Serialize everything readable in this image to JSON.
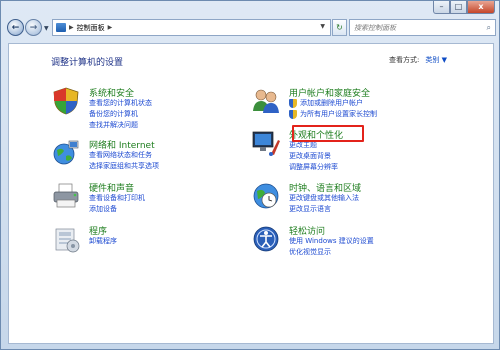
{
  "window": {
    "controls": {
      "minimize": "–",
      "maximize": "□",
      "close": "x"
    }
  },
  "nav": {
    "back_icon": "←",
    "forward_icon": "→",
    "breadcrumb": [
      "控制面板"
    ],
    "refresh_icon": "↻",
    "search_placeholder": "搜索控制面板"
  },
  "page": {
    "title": "调整计算机的设置",
    "view_by_label": "查看方式:",
    "view_by_value": "类别 ▼"
  },
  "categories": [
    {
      "title": "系统和安全",
      "links": [
        "查看您的计算机状态",
        "备份您的计算机",
        "查找并解决问题"
      ]
    },
    {
      "title": "网络和 Internet",
      "links": [
        "查看网络状态和任务",
        "选择家庭组和共享选项"
      ]
    },
    {
      "title": "硬件和声音",
      "links": [
        "查看设备和打印机",
        "添加设备"
      ]
    },
    {
      "title": "程序",
      "links": [
        "卸载程序"
      ]
    },
    {
      "title": "用户帐户和家庭安全",
      "links": [
        "添加或删除用户帐户",
        "为所有用户设置家长控制"
      ]
    },
    {
      "title": "外观和个性化",
      "links": [
        "更改主题",
        "更改桌面背景",
        "调整屏幕分辨率"
      ]
    },
    {
      "title": "时钟、语言和区域",
      "links": [
        "更改键盘或其他输入法",
        "更改显示语言"
      ]
    },
    {
      "title": "轻松访问",
      "links": [
        "使用 Windows 建议的设置",
        "优化视觉显示"
      ]
    }
  ],
  "colors": {
    "category_title": "#1e7d1e",
    "link": "#1d4ad1",
    "page_title": "#1e3287",
    "highlight": "#e3231b"
  }
}
